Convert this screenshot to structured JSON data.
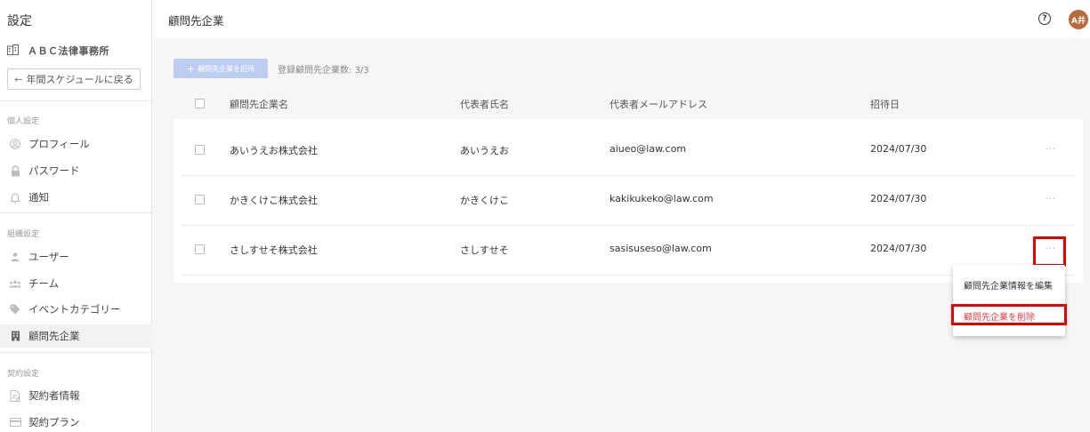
{
  "sidebar": {
    "title": "設定",
    "org_name": "ＡＢＣ法律事務所",
    "back_label": "年間スケジュールに戻る",
    "sections": {
      "personal": "個人設定",
      "organization": "組織設定",
      "contract": "契約設定"
    },
    "items": [
      {
        "label": "プロフィール",
        "icon": "profile-icon"
      },
      {
        "label": "パスワード",
        "icon": "lock-icon"
      },
      {
        "label": "通知",
        "icon": "bell-icon"
      },
      {
        "label": "ユーザー",
        "icon": "user-icon"
      },
      {
        "label": "チーム",
        "icon": "team-icon"
      },
      {
        "label": "イベントカテゴリー",
        "icon": "tag-icon"
      },
      {
        "label": "顧問先企業",
        "icon": "building-icon",
        "active": true
      },
      {
        "label": "契約者情報",
        "icon": "document-icon"
      },
      {
        "label": "契約プラン",
        "icon": "card-icon"
      }
    ]
  },
  "header": {
    "title": "顧問先企業",
    "help": "?",
    "avatar": "A井"
  },
  "toolbar": {
    "invite_label": "顧問先企業を招待",
    "count_label": "登録顧問先企業数: 3/3"
  },
  "table": {
    "columns": [
      "顧問先企業名",
      "代表者氏名",
      "代表者メールアドレス",
      "招待日"
    ],
    "rows": [
      {
        "company": "あいうえお株式会社",
        "rep": "あいうえお",
        "email": "aiueo@law.com",
        "date": "2024/07/30"
      },
      {
        "company": "かきくけこ株式会社",
        "rep": "かきくけこ",
        "email": "kakikukeko@law.com",
        "date": "2024/07/30"
      },
      {
        "company": "さしすせそ株式会社",
        "rep": "さしすせそ",
        "email": "sasisuseso@law.com",
        "date": "2024/07/30"
      }
    ],
    "more_label": "···"
  },
  "menu": {
    "edit_label": "顧問先企業情報を編集",
    "delete_label": "顧問先企業を削除"
  },
  "colors": {
    "accent_disabled": "#bccdef",
    "danger": "#e0404b",
    "highlight": "#e00000",
    "avatar": "#b86a3a"
  }
}
